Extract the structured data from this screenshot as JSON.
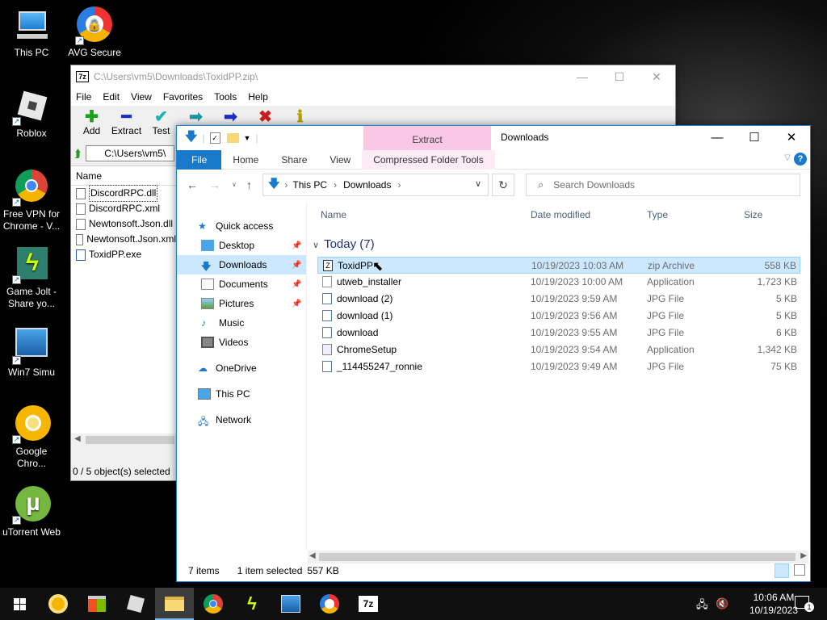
{
  "desktop": {
    "icons": [
      {
        "label": "This PC",
        "icon": "computer-icon"
      },
      {
        "label": "AVG Secure B...",
        "icon": "avg-browser-icon"
      },
      {
        "label": "Roblox",
        "icon": "roblox-icon"
      },
      {
        "label": "Free VPN for Chrome - V...",
        "icon": "chrome-vpn-icon"
      },
      {
        "label": "Game Jolt - Share yo...",
        "icon": "gamejolt-icon"
      },
      {
        "label": "Win7 Simu",
        "icon": "win7-icon"
      },
      {
        "label": "Google Chro...",
        "icon": "chrome-canary-icon"
      },
      {
        "label": "uTorrent Web",
        "icon": "utorrent-icon"
      }
    ]
  },
  "sevenzip": {
    "title": "C:\\Users\\vm5\\Downloads\\ToxidPP.zip\\",
    "logo": "7z",
    "menu": [
      "File",
      "Edit",
      "View",
      "Favorites",
      "Tools",
      "Help"
    ],
    "tools": [
      {
        "label": "Add",
        "glyph": "✚",
        "color": "#1aa31a"
      },
      {
        "label": "Extract",
        "glyph": "━",
        "color": "#1c2fbf"
      },
      {
        "label": "Test",
        "glyph": "✔",
        "color": "#1bb3b3"
      },
      {
        "label": "",
        "glyph": "➡",
        "color": "#1a9aa0"
      },
      {
        "label": "",
        "glyph": "➡",
        "color": "#1c2fbf"
      },
      {
        "label": "",
        "glyph": "✖",
        "color": "#d01c1c"
      },
      {
        "label": "",
        "glyph": "ℹ",
        "color": "#b3a000"
      }
    ],
    "path": "C:\\Users\\vm5\\",
    "column_name": "Name",
    "files": [
      "DiscordRPC.dll",
      "DiscordRPC.xml",
      "Newtonsoft.Json.dll",
      "Newtonsoft.Json.xml",
      "ToxidPP.exe"
    ],
    "status": "0 / 5 object(s) selected"
  },
  "explorer": {
    "title": "Downloads",
    "context_tab": "Extract",
    "ribbon_tabs": [
      "File",
      "Home",
      "Share",
      "View"
    ],
    "ribbon_ctx": "Compressed Folder Tools",
    "breadcrumb": [
      "This PC",
      "Downloads"
    ],
    "search_placeholder": "Search Downloads",
    "nav": [
      {
        "label": "Quick access",
        "pin": false
      },
      {
        "label": "Desktop",
        "pin": true
      },
      {
        "label": "Downloads",
        "pin": true
      },
      {
        "label": "Documents",
        "pin": true
      },
      {
        "label": "Pictures",
        "pin": true
      },
      {
        "label": "Music",
        "pin": false
      },
      {
        "label": "Videos",
        "pin": false
      },
      {
        "label": "OneDrive",
        "pin": false
      },
      {
        "label": "This PC",
        "pin": false
      },
      {
        "label": "Network",
        "pin": false
      }
    ],
    "columns": {
      "name": "Name",
      "date": "Date modified",
      "type": "Type",
      "size": "Size"
    },
    "group": "Today (7)",
    "files": [
      {
        "name": "ToxidPP",
        "date": "10/19/2023 10:03 AM",
        "type": "zip Archive",
        "size": "558 KB"
      },
      {
        "name": "utweb_installer",
        "date": "10/19/2023 10:00 AM",
        "type": "Application",
        "size": "1,723 KB"
      },
      {
        "name": "download (2)",
        "date": "10/19/2023 9:59 AM",
        "type": "JPG File",
        "size": "5 KB"
      },
      {
        "name": "download (1)",
        "date": "10/19/2023 9:56 AM",
        "type": "JPG File",
        "size": "5 KB"
      },
      {
        "name": "download",
        "date": "10/19/2023 9:55 AM",
        "type": "JPG File",
        "size": "6 KB"
      },
      {
        "name": "ChromeSetup",
        "date": "10/19/2023 9:54 AM",
        "type": "Application",
        "size": "1,342 KB"
      },
      {
        "name": "_114455247_ronnie",
        "date": "10/19/2023 9:49 AM",
        "type": "JPG File",
        "size": "75 KB"
      }
    ],
    "status": {
      "count": "7 items",
      "selected": "1 item selected",
      "size": "557 KB"
    }
  },
  "taskbar": {
    "time": "10:06 AM",
    "date": "10/19/2023",
    "notif": "1"
  }
}
